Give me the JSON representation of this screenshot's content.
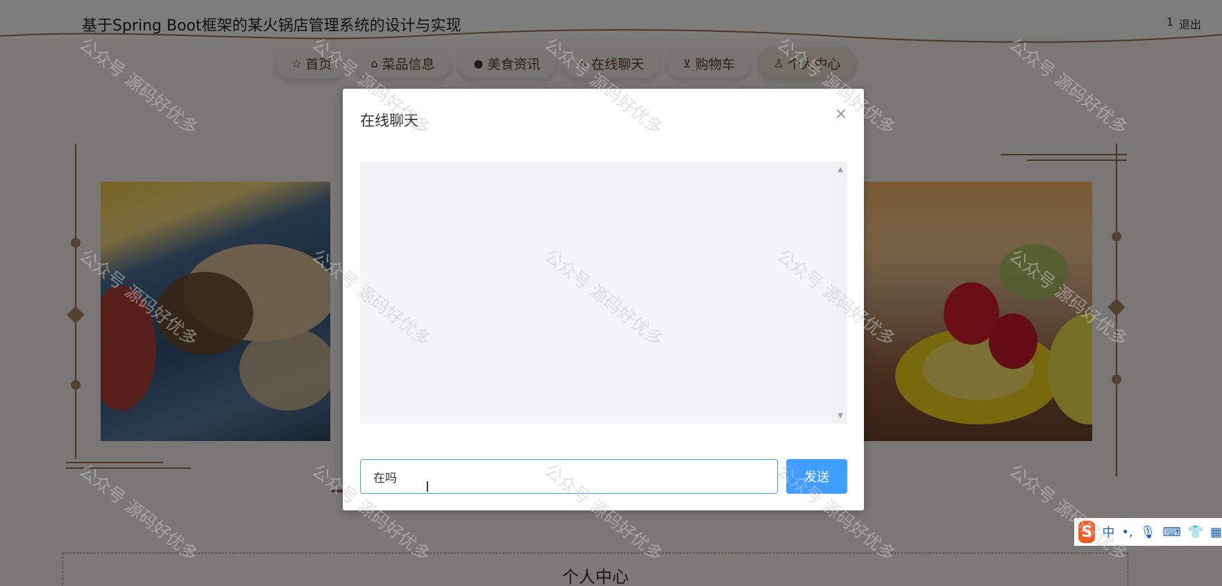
{
  "site": {
    "title": "基于Spring Boot框架的某火锅店管理系统的设计与实现",
    "user": "1",
    "logout": "退出"
  },
  "nav": {
    "items": [
      {
        "label": "首页",
        "icon": "star-icon",
        "glyph": "☆"
      },
      {
        "label": "菜品信息",
        "icon": "bag-icon",
        "glyph": "⌂"
      },
      {
        "label": "美食资讯",
        "icon": "info-icon",
        "glyph": "●"
      },
      {
        "label": "在线聊天",
        "icon": "headset-icon",
        "glyph": "∩"
      },
      {
        "label": "购物车",
        "icon": "cart-icon",
        "glyph": "⊻"
      },
      {
        "label": "个人中心",
        "icon": "user-icon",
        "glyph": "♙"
      }
    ]
  },
  "section": {
    "title": "个人中心"
  },
  "dialog": {
    "title": "在线聊天",
    "close_glyph": "×",
    "input_value": "在吗",
    "send_label": "发送"
  },
  "ime": {
    "logo": "S",
    "mode": "中",
    "punct": "•,",
    "mic": "🎙",
    "keyboard": "⌨",
    "skin": "👕",
    "grid": "▦"
  },
  "watermark": "公众号 源码好优多",
  "colors": {
    "accent": "#409eff",
    "nav_text": "#5a3f2c",
    "deco": "#8e6f52"
  }
}
